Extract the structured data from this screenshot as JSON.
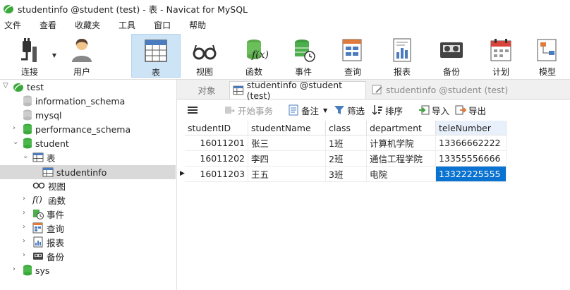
{
  "window": {
    "title": "studentinfo @student (test) - 表 - Navicat for MySQL"
  },
  "menu": [
    "文件",
    "查看",
    "收藏夹",
    "工具",
    "窗口",
    "帮助"
  ],
  "toolbar": {
    "connect": "连接",
    "user": "用户",
    "table": "表",
    "view": "视图",
    "function": "函数",
    "event": "事件",
    "query": "查询",
    "report": "报表",
    "backup": "备份",
    "schedule": "计划",
    "model": "模型"
  },
  "tree": {
    "root": "test",
    "items": [
      "information_schema",
      "mysql",
      "performance_schema",
      "student"
    ],
    "student_children": {
      "tables": "表",
      "table_item": "studentinfo",
      "views": "视图",
      "functions": "函数",
      "events": "事件",
      "queries": "查询",
      "reports": "报表",
      "backups": "备份"
    },
    "sys": "sys"
  },
  "tabs": {
    "objects": "对象",
    "active": "studentinfo @student (test)",
    "inactive": "studentinfo @student (test)"
  },
  "subtoolbar": {
    "begin": "开始事务",
    "note": "备注",
    "filter": "筛选",
    "sort": "排序",
    "import": "导入",
    "export": "导出"
  },
  "table": {
    "columns": [
      "studentID",
      "studentName",
      "class",
      "department",
      "teleNumber"
    ],
    "rows": [
      [
        "16011201",
        "张三",
        "1班",
        "计算机学院",
        "13366662222"
      ],
      [
        "16011202",
        "李四",
        "2班",
        "通信工程学院",
        "13355556666"
      ],
      [
        "16011203",
        "王五",
        "3班",
        "电院",
        "13322225555"
      ]
    ]
  }
}
